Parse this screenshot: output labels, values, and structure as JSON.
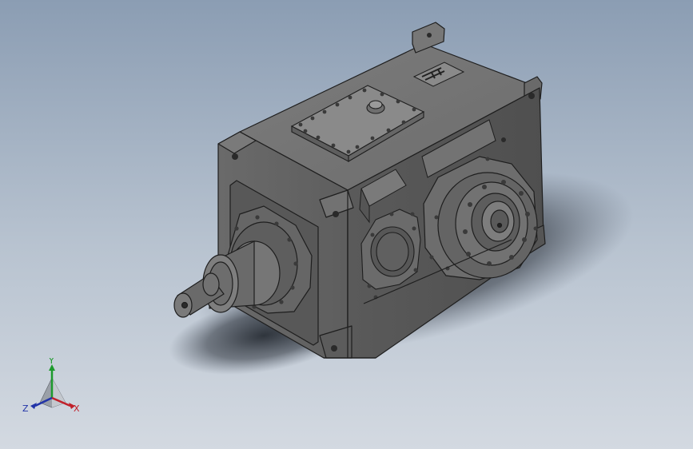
{
  "view": {
    "background_top": "#8b9db3",
    "background_bottom": "#d3d9e1",
    "model_color": "#6e6e6e"
  },
  "model": {
    "name": "gearbox",
    "logo_icon": "manufacturer-logo-icon"
  },
  "triad": {
    "x_label": "X",
    "y_label": "Y",
    "z_label": "Z",
    "x_color": "#c0202a",
    "y_color": "#1d9a2d",
    "z_color": "#2133a8"
  }
}
